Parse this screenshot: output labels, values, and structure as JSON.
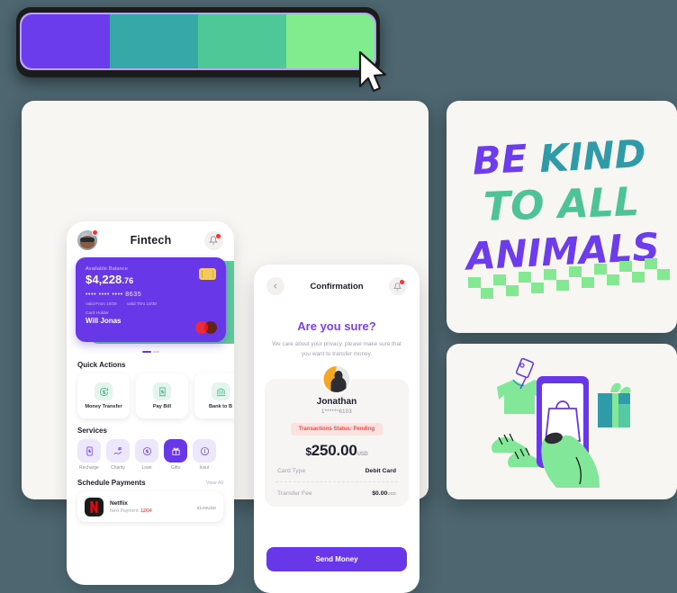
{
  "palette": {
    "name": "color-palette-bar",
    "swatches": [
      "#6a3ceb",
      "#37a8a8",
      "#4fc897",
      "#81ec8e"
    ],
    "border_color": "#b9a3f5",
    "frame_color": "#1b1b1b"
  },
  "background_color": "#4d6670",
  "panel_color": "#f7f6f3",
  "fintech": {
    "header": {
      "title": "Fintech",
      "avatar": "user-avatar",
      "bell": "notification-bell-icon"
    },
    "card": {
      "balance_label": "Available Balance",
      "balance": "$4,228",
      "balance_cents": ".76",
      "number": "••••  ••••  ••••  8635",
      "valid_from": "Valid From 10/28",
      "valid_thru": "Valid Thru 10/30",
      "holder_label": "Card Holder",
      "holder": "Will Jonas",
      "brand": "mastercard-logo",
      "bg_color": "#6838e8",
      "next_card_color": "#5ecb97"
    },
    "quick_actions": {
      "title": "Quick Actions",
      "items": [
        {
          "label": "Money Transfer",
          "icon": "money-transfer-icon"
        },
        {
          "label": "Pay Bill",
          "icon": "bill-icon"
        },
        {
          "label": "Bank to B",
          "icon": "bank-icon"
        }
      ]
    },
    "services": {
      "title": "Services",
      "items": [
        {
          "label": "Recharge",
          "icon": "recharge-icon",
          "active": false
        },
        {
          "label": "Charity",
          "icon": "charity-hand-icon",
          "active": false
        },
        {
          "label": "Loan",
          "icon": "loan-coin-icon",
          "active": false
        },
        {
          "label": "Gifts",
          "icon": "gift-icon",
          "active": true
        },
        {
          "label": "Insur",
          "icon": "insurance-icon",
          "active": false
        }
      ]
    },
    "schedule": {
      "title": "Schedule Payments",
      "view_all": "View All",
      "rows": [
        {
          "name": "Netflix",
          "logo": "netflix-logo",
          "next_label": "Next Payment: ",
          "next_date": "12/04",
          "amount": "$1.00",
          "currency": "USD"
        }
      ]
    }
  },
  "confirmation": {
    "back": "back-chevron-icon",
    "title": "Confirmation",
    "bell": "notification-bell-icon",
    "heading": "Are you sure?",
    "subtext": "We care about your privacy. please make sure that you want to transfer money.",
    "recipient": {
      "avatar": "recipient-avatar",
      "name": "Jonathan",
      "account": "1******6103",
      "status_badge": "Transactions Status: Pending",
      "badge_bg": "#fde0e0",
      "badge_color": "#f4483f",
      "amount_currency_symbol": "$",
      "amount": "250.00",
      "amount_unit": "USD"
    },
    "rows": [
      {
        "key": "Card Type",
        "value": "Debit Card",
        "unit": ""
      },
      {
        "key": "Transfer Fee",
        "value": "$0.00",
        "unit": "USD"
      }
    ],
    "submit": "Send Money",
    "accent_color": "#6838e8",
    "heading_color": "#7b3ff2"
  },
  "kind_poster": {
    "name": "be-kind-to-all-animals-poster",
    "lines": [
      {
        "text": "BE",
        "color": "#6d3ced"
      },
      {
        "text": "KIND",
        "color": "#2f9aa8"
      },
      {
        "text": "TO ALL",
        "color": "#4ec396"
      },
      {
        "text": "ANIMALS",
        "color": "#6d3ced"
      }
    ],
    "checker_color": "#84e791"
  },
  "shopping_art": {
    "name": "mobile-shopping-illustration",
    "elements": [
      "t-shirt",
      "price-tag",
      "smartphone",
      "shopping-bag",
      "hand",
      "sneakers",
      "gift-box"
    ],
    "phone_color": "#6838e8",
    "hand_color": "#83e79a",
    "gift_color": "#2f9aa8",
    "bag_outline": "#6838e8"
  },
  "cursor": {
    "name": "mouse-pointer"
  }
}
